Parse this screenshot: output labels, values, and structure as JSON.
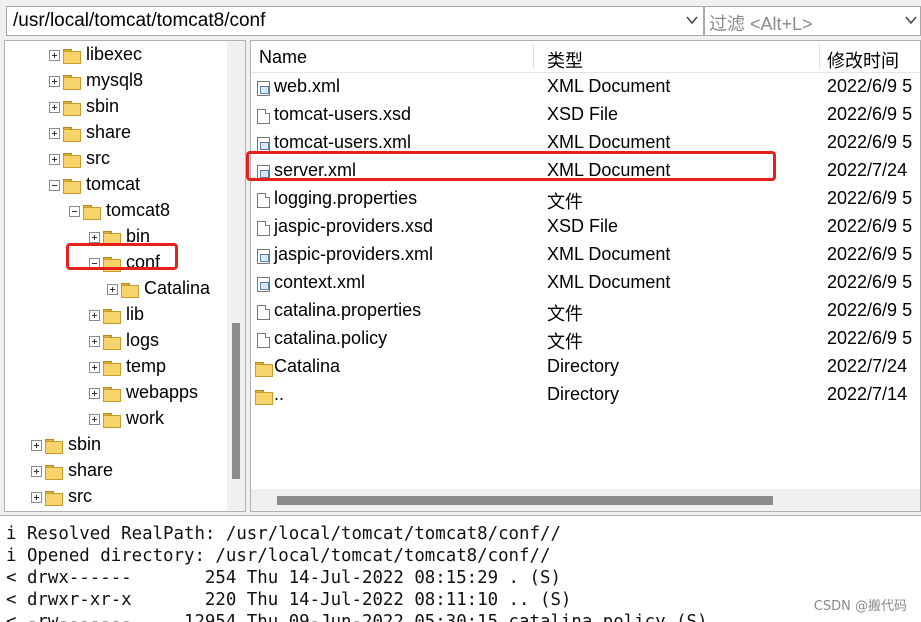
{
  "toolbar": {
    "path": "/usr/local/tomcat/tomcat8/conf",
    "filter_placeholder": "过滤 <Alt+L>"
  },
  "tree": [
    {
      "label": "libexec",
      "level": 2,
      "expander": "plus",
      "id": "libexec"
    },
    {
      "label": "mysql8",
      "level": 2,
      "expander": "plus",
      "id": "mysql8"
    },
    {
      "label": "sbin",
      "level": 2,
      "expander": "plus",
      "id": "sbin-local"
    },
    {
      "label": "share",
      "level": 2,
      "expander": "plus",
      "id": "share-local"
    },
    {
      "label": "src",
      "level": 2,
      "expander": "plus",
      "id": "src-local"
    },
    {
      "label": "tomcat",
      "level": 2,
      "expander": "minus",
      "id": "tomcat"
    },
    {
      "label": "tomcat8",
      "level": 3,
      "expander": "minus",
      "id": "tomcat8"
    },
    {
      "label": "bin",
      "level": 4,
      "expander": "plus",
      "id": "bin"
    },
    {
      "label": "conf",
      "level": 4,
      "expander": "minus",
      "id": "conf"
    },
    {
      "label": "Catalina",
      "level": 5,
      "expander": "plus",
      "id": "catalina"
    },
    {
      "label": "lib",
      "level": 4,
      "expander": "plus",
      "id": "lib"
    },
    {
      "label": "logs",
      "level": 4,
      "expander": "plus",
      "id": "logs"
    },
    {
      "label": "temp",
      "level": 4,
      "expander": "plus",
      "id": "temp"
    },
    {
      "label": "webapps",
      "level": 4,
      "expander": "plus",
      "id": "webapps"
    },
    {
      "label": "work",
      "level": 4,
      "expander": "plus",
      "id": "work"
    },
    {
      "label": "sbin",
      "level": 1,
      "expander": "plus",
      "id": "sbin"
    },
    {
      "label": "share",
      "level": 1,
      "expander": "plus",
      "id": "share"
    },
    {
      "label": "src",
      "level": 1,
      "expander": "plus",
      "id": "src"
    }
  ],
  "files": {
    "columns": {
      "name": "Name",
      "type": "类型",
      "modified": "修改时间"
    },
    "rows": [
      {
        "name": "web.xml",
        "type": "XML Document",
        "modified": "2022/6/9 5",
        "icon": "xml-file-icon"
      },
      {
        "name": "tomcat-users.xsd",
        "type": "XSD File",
        "modified": "2022/6/9 5",
        "icon": "file-icon"
      },
      {
        "name": "tomcat-users.xml",
        "type": "XML Document",
        "modified": "2022/6/9 5",
        "icon": "xml-file-icon"
      },
      {
        "name": "server.xml",
        "type": "XML Document",
        "modified": "2022/7/24",
        "icon": "xml-file-icon"
      },
      {
        "name": "logging.properties",
        "type": "文件",
        "modified": "2022/6/9 5",
        "icon": "file-icon"
      },
      {
        "name": "jaspic-providers.xsd",
        "type": "XSD File",
        "modified": "2022/6/9 5",
        "icon": "file-icon"
      },
      {
        "name": "jaspic-providers.xml",
        "type": "XML Document",
        "modified": "2022/6/9 5",
        "icon": "xml-file-icon"
      },
      {
        "name": "context.xml",
        "type": "XML Document",
        "modified": "2022/6/9 5",
        "icon": "xml-file-icon"
      },
      {
        "name": "catalina.properties",
        "type": "文件",
        "modified": "2022/6/9 5",
        "icon": "file-icon"
      },
      {
        "name": "catalina.policy",
        "type": "文件",
        "modified": "2022/6/9 5",
        "icon": "file-icon"
      },
      {
        "name": "Catalina",
        "type": "Directory",
        "modified": "2022/7/24",
        "icon": "folder-icon"
      },
      {
        "name": "..",
        "type": "Directory",
        "modified": "2022/7/14",
        "icon": "folder-icon"
      }
    ]
  },
  "log": [
    "i Resolved RealPath: /usr/local/tomcat/tomcat8/conf//",
    "i Opened directory: /usr/local/tomcat/tomcat8/conf//",
    "< drwx------       254 Thu 14-Jul-2022 08:15:29 . (S)",
    "< drwxr-xr-x       220 Thu 14-Jul-2022 08:11:10 .. (S)",
    "< -rw-------     12954 Thu 09-Jun-2022 05:30:15 catalina.policy (S)"
  ],
  "watermark": "CSDN @搬代码",
  "colors": {
    "highlight": "#e8201c",
    "folder": "#f6d36b"
  }
}
